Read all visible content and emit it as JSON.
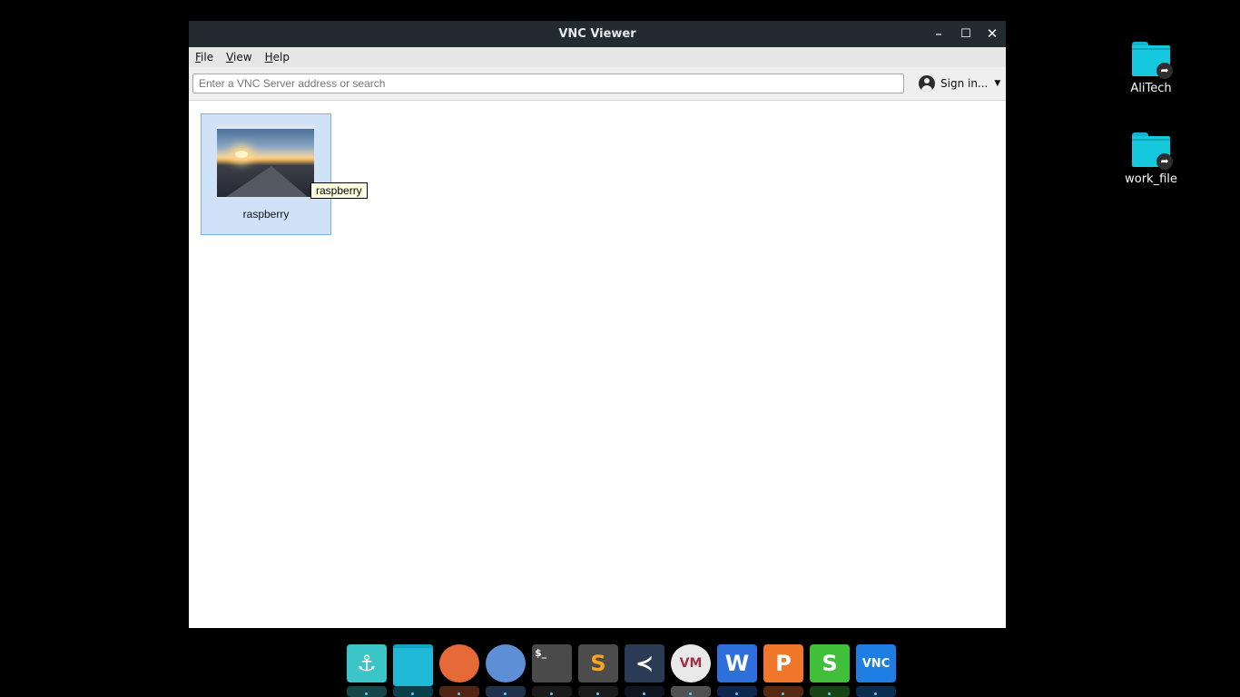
{
  "desktop": {
    "icons": [
      {
        "label": "AliTech",
        "icon": "shared-folder-icon"
      },
      {
        "label": "work_file",
        "icon": "shared-folder-icon"
      }
    ]
  },
  "window": {
    "title": "VNC Viewer",
    "controls": {
      "minimize": "–",
      "maximize": "☐",
      "close": "✕"
    }
  },
  "menu": {
    "file": "File",
    "view": "View",
    "help": "Help"
  },
  "toolbar": {
    "search_placeholder": "Enter a VNC Server address or search",
    "sign_in": "Sign in..."
  },
  "connections": [
    {
      "label": "raspberry",
      "tooltip": "raspberry"
    }
  ],
  "dock": {
    "items": [
      {
        "name": "anchor",
        "glyph": "⚓",
        "color": "#3cc5c8"
      },
      {
        "name": "files",
        "glyph": "",
        "color": "#1fb8d6"
      },
      {
        "name": "firefox",
        "glyph": "",
        "color": "#e66a37"
      },
      {
        "name": "chromium",
        "glyph": "",
        "color": "#5c8fd6"
      },
      {
        "name": "terminal",
        "glyph": "$_",
        "color": "#4a4a4a"
      },
      {
        "name": "sublime",
        "glyph": "S",
        "color": "#4c4c4c"
      },
      {
        "name": "vscode",
        "glyph": "≺",
        "color": "#2a3c55"
      },
      {
        "name": "vm",
        "glyph": "VM",
        "color": "#e9e9e9"
      },
      {
        "name": "wps-writer",
        "glyph": "W",
        "color": "#2f6fdc"
      },
      {
        "name": "wps-presentation",
        "glyph": "P",
        "color": "#f0762a"
      },
      {
        "name": "wps-spreadsheet",
        "glyph": "S",
        "color": "#3fbf3a"
      },
      {
        "name": "vnc-viewer",
        "glyph": "VNC",
        "color": "#1e7ee3"
      }
    ]
  }
}
